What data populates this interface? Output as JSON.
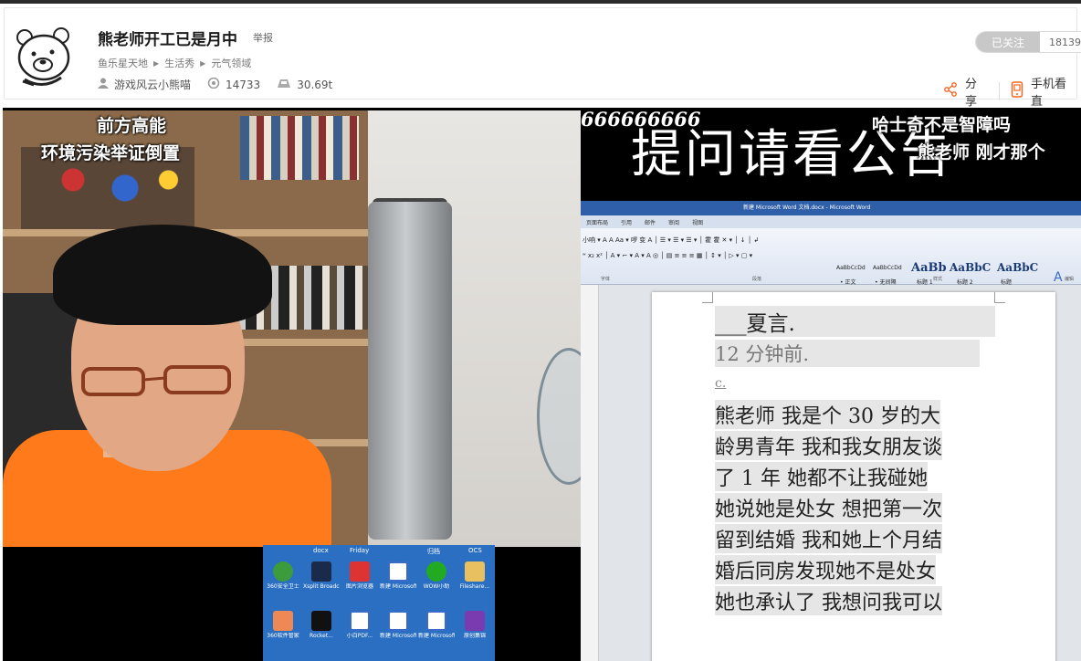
{
  "header": {
    "title": "熊老师开工已是月中",
    "report_label": "举报",
    "breadcrumbs": [
      "鱼乐星天地",
      "生活秀",
      "元气领域"
    ],
    "streamer": "游戏风云小熊喵",
    "viewers": "14733",
    "weight": "30.69t",
    "follow_label": "已关注",
    "follow_count": "18139",
    "share_label": "分享",
    "mobile_label": "手机看直",
    "accent_color": "#f26522"
  },
  "video": {
    "cam_caption_1": "前方高能",
    "cam_caption_2": "环境污染举证倒置",
    "banner_number": "666666666",
    "banner_main": "提问请看公告",
    "danmu_1": "哈士奇不是智障吗",
    "danmu_2": "熊老师 刚才那个",
    "word": {
      "window_title": "新建 Microsoft Word 文档.docx - Microsoft Word",
      "tabs": [
        "页面布局",
        "引用",
        "邮件",
        "审阅",
        "视图"
      ],
      "styles": [
        "AaBbCcDd",
        "AaBbCcDd",
        "AaBb",
        "AaBbC",
        "AaBbC"
      ],
      "style_names": [
        "• 正文",
        "• 无间隔",
        "标题 1",
        "标题 2",
        "标题"
      ],
      "group_labels": [
        "字体",
        "段落",
        "样式",
        "编辑"
      ],
      "doc_lines": [
        "___夏言.",
        "12 分钟前.",
        "c.",
        "熊老师 我是个 30 岁的大",
        "龄男青年 我和我女朋友谈",
        "了 1 年 她都不让我碰她",
        "她说她是处女 想把第一次",
        "留到结婚 我和她上个月结",
        "婚后同房发现她不是处女",
        "她也承认了 我想问我可以"
      ]
    },
    "desktop": {
      "top_labels": [
        "docx",
        "Friday",
        "归档",
        "OCS"
      ],
      "icons_row1": [
        "360安全卫士",
        "Xsplit Broadcaster",
        "图片浏览器",
        "新建 Microsoft...",
        "WOW小助",
        "Fileshare..."
      ],
      "icons_row2": [
        "360软件管家",
        "Rocket...",
        "小白PDF...",
        "新建 Microsoft...",
        "新建 Microsoft...",
        "原创集锦"
      ]
    }
  }
}
